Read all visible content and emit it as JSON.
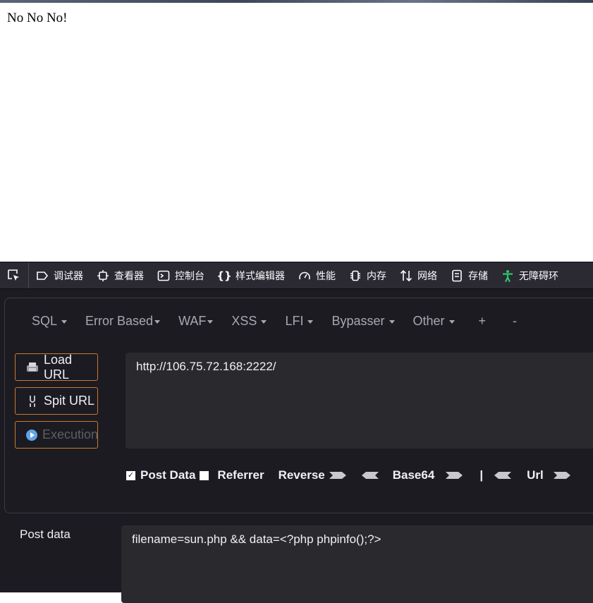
{
  "page": {
    "content_text": "No No No!"
  },
  "devtools": {
    "tabs": [
      {
        "label": "调试器",
        "icon": "debugger-icon"
      },
      {
        "label": "查看器",
        "icon": "inspector-icon"
      },
      {
        "label": "控制台",
        "icon": "console-icon"
      },
      {
        "label": "样式编辑器",
        "icon": "style-editor-icon"
      },
      {
        "label": "性能",
        "icon": "performance-icon"
      },
      {
        "label": "内存",
        "icon": "memory-icon"
      },
      {
        "label": "网络",
        "icon": "network-icon"
      },
      {
        "label": "存储",
        "icon": "storage-icon"
      },
      {
        "label": "无障碍环",
        "icon": "accessibility-icon"
      }
    ]
  },
  "hackbar": {
    "menu": [
      "SQL",
      "Error Based",
      "WAF",
      "XSS",
      "LFI",
      "Bypasser",
      "Other",
      "+",
      "-"
    ],
    "buttons": {
      "load_url": "Load URL",
      "split_url": "Spit URL",
      "execution": "Execution"
    },
    "url_value": "http://106.75.72.168:2222/",
    "options": {
      "post_data": "Post Data",
      "post_data_checked": true,
      "referrer": "Referrer",
      "referrer_checked": false,
      "reverse": "Reverse",
      "base64": "Base64",
      "separator": "|",
      "url": "Url"
    },
    "post_label": "Post data",
    "post_value": "filename=sun.php && data=<?php phpinfo();?>"
  },
  "colors": {
    "devtools_bg": "#1c1b22",
    "toolbar_bg": "#2b2a33",
    "button_border": "#c97a2c",
    "input_bg": "#2a2a2e"
  }
}
